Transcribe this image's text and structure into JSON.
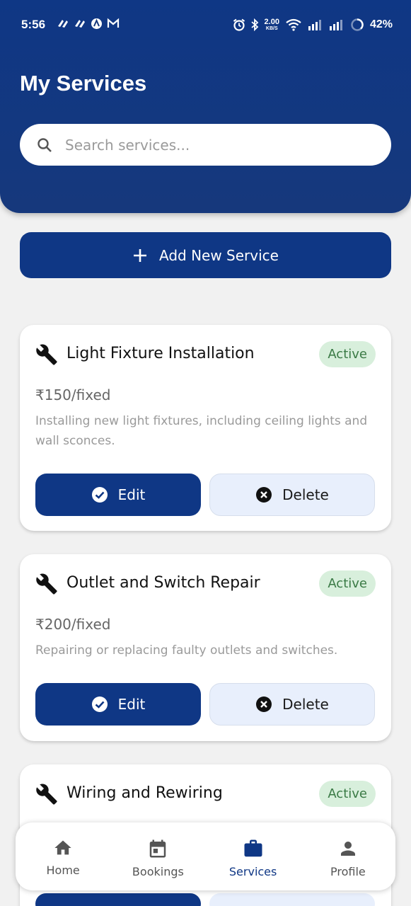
{
  "status_bar": {
    "time": "5:56",
    "speed_value": "2.00",
    "speed_unit": "KB/S",
    "battery": "42%"
  },
  "header": {
    "title": "My Services"
  },
  "search": {
    "placeholder": "Search services..."
  },
  "add_button": {
    "label": "Add New Service"
  },
  "services": [
    {
      "title": "Light Fixture Installation",
      "status": "Active",
      "price": "₹150/fixed",
      "description": "Installing new light fixtures, including ceiling lights and wall sconces.",
      "edit_label": "Edit",
      "delete_label": "Delete"
    },
    {
      "title": "Outlet and Switch Repair",
      "status": "Active",
      "price": "₹200/fixed",
      "description": "Repairing or replacing faulty outlets and switches.",
      "edit_label": "Edit",
      "delete_label": "Delete"
    },
    {
      "title": "Wiring and Rewiring",
      "status": "Active"
    }
  ],
  "bottom_nav": {
    "items": [
      {
        "label": "Home",
        "icon": "home-icon"
      },
      {
        "label": "Bookings",
        "icon": "calendar-icon"
      },
      {
        "label": "Services",
        "icon": "briefcase-icon",
        "active": true
      },
      {
        "label": "Profile",
        "icon": "person-icon"
      }
    ]
  },
  "colors": {
    "primary": "#0f3785",
    "badge_bg": "#d8efdc",
    "badge_text": "#3a7a45",
    "delete_bg": "#e8effc",
    "background": "#f1f1f1"
  }
}
